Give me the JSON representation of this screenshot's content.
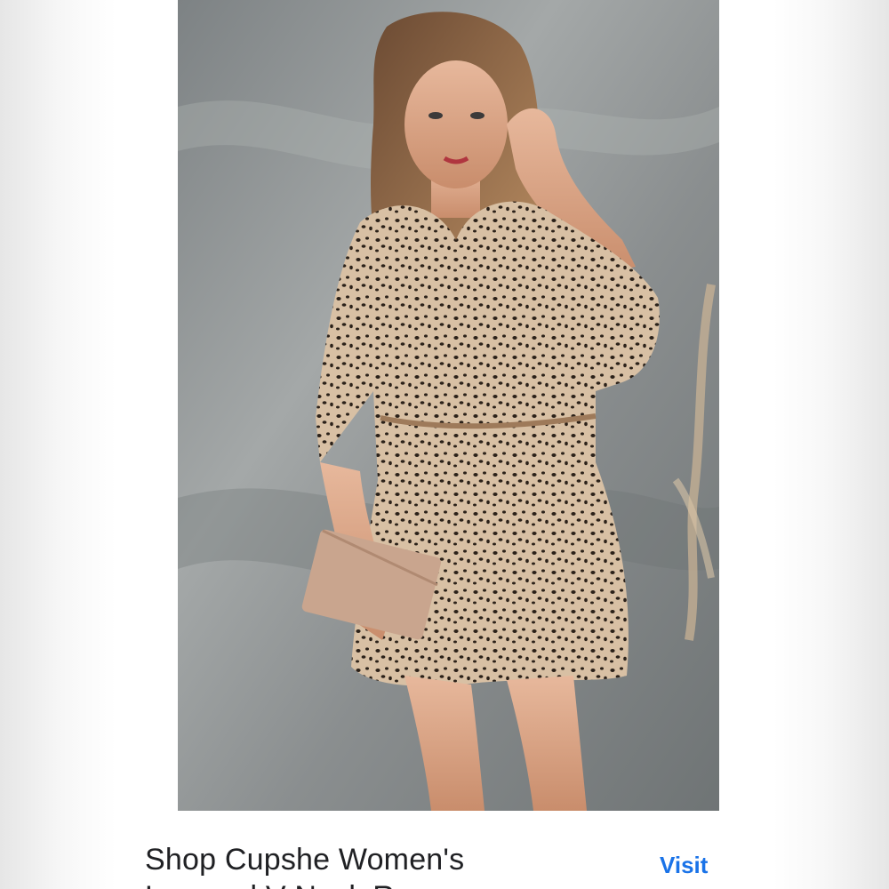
{
  "result": {
    "title": "Shop Cupshe Women's",
    "title_cont": "Leopard V-Neck Romper",
    "visit_label": "Visit",
    "link_color": "#1a73e8"
  },
  "image": {
    "subject": "model in leopard print romper holding clutch"
  }
}
